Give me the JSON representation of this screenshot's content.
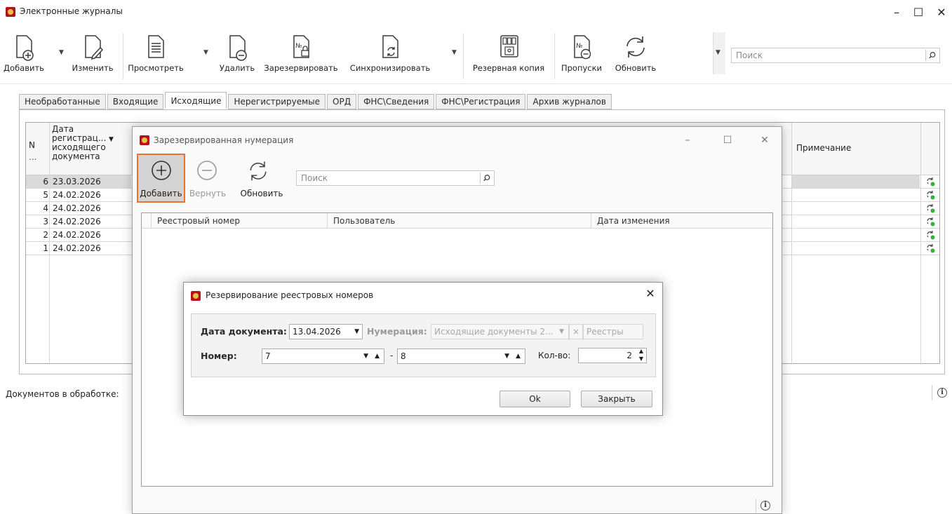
{
  "window": {
    "title": "Электронные журналы",
    "controls": {
      "minimize": "–",
      "maximize": "☐",
      "close": "✕"
    }
  },
  "toolbar": {
    "add": "Добавить",
    "edit": "Изменить",
    "view": "Просмотреть",
    "delete": "Удалить",
    "reserve": "Зарезервировать",
    "sync": "Синхронизировать",
    "backup": "Резервная копия",
    "skips": "Пропуски",
    "refresh": "Обновить",
    "search_placeholder": "Поиск"
  },
  "tabs": [
    {
      "label": "Необработанные"
    },
    {
      "label": "Входящие"
    },
    {
      "label": "Исходящие",
      "active": true
    },
    {
      "label": "Нерегистрируемые"
    },
    {
      "label": "ОРД"
    },
    {
      "label": "ФНС\\Сведения"
    },
    {
      "label": "ФНС\\Регистрация"
    },
    {
      "label": "Архив журналов"
    }
  ],
  "grid": {
    "col_n": "N",
    "col_n_sub": "...",
    "col_date_lines": [
      "Дата",
      "регистрац...",
      "исходящего",
      "документа"
    ],
    "col_note": "Примечание",
    "rows": [
      {
        "n": "6",
        "date": "23.03.2026"
      },
      {
        "n": "5",
        "date": "24.02.2026"
      },
      {
        "n": "4",
        "date": "24.02.2026"
      },
      {
        "n": "3",
        "date": "24.02.2026"
      },
      {
        "n": "2",
        "date": "24.02.2026"
      },
      {
        "n": "1",
        "date": "24.02.2026"
      }
    ]
  },
  "status": {
    "docs_in_processing": "Документов в обработке:"
  },
  "reserved_dialog": {
    "title": "Зарезервированная нумерация",
    "add": "Добавить",
    "return": "Вернуть",
    "refresh": "Обновить",
    "search_placeholder": "Поиск",
    "columns": [
      "Реестровый номер",
      "Пользователь",
      "Дата изменения"
    ]
  },
  "reserve_dialog": {
    "title": "Резервирование реестровых номеров",
    "doc_date_label": "Дата документа:",
    "doc_date_value": "13.04.2026",
    "numbering_label": "Нумерация:",
    "numbering_value": "Исходящие документы 2...",
    "registries": "Реестры",
    "number_label": "Номер:",
    "number_from": "7",
    "number_to": "8",
    "dash": "-",
    "count_label": "Кол-во:",
    "count_value": "2",
    "ok": "Ok",
    "close": "Закрыть"
  },
  "icons": [
    "app-logo-icon",
    "add-doc-icon",
    "edit-doc-icon",
    "view-doc-icon",
    "delete-doc-icon",
    "reserve-icon",
    "sync-icon",
    "backup-icon",
    "skips-icon",
    "refresh-icon",
    "search-icon",
    "info-icon"
  ]
}
